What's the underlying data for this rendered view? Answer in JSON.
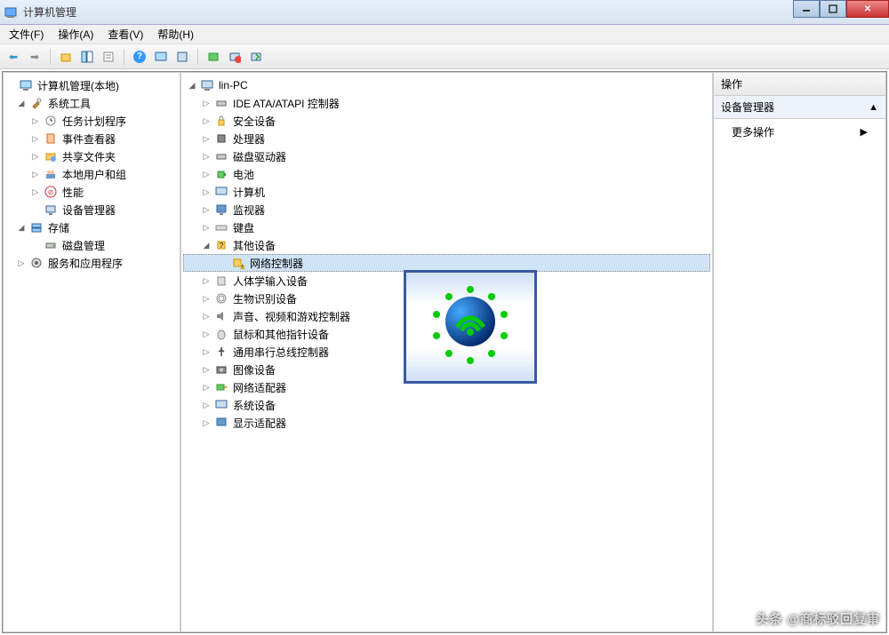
{
  "window": {
    "title": "计算机管理"
  },
  "menu": {
    "file": "文件(F)",
    "action": "操作(A)",
    "view": "查看(V)",
    "help": "帮助(H)"
  },
  "left_tree": {
    "root": "计算机管理(本地)",
    "system_tools": "系统工具",
    "task_scheduler": "任务计划程序",
    "event_viewer": "事件查看器",
    "shared_folders": "共享文件夹",
    "local_users": "本地用户和组",
    "performance": "性能",
    "device_manager": "设备管理器",
    "storage": "存储",
    "disk_management": "磁盘管理",
    "services_apps": "服务和应用程序"
  },
  "center_tree": {
    "computer": "lin-PC",
    "ide_atapi": "IDE ATA/ATAPI 控制器",
    "security_devices": "安全设备",
    "processors": "处理器",
    "disk_drives": "磁盘驱动器",
    "batteries": "电池",
    "computer_node": "计算机",
    "monitors": "监视器",
    "keyboards": "键盘",
    "other_devices": "其他设备",
    "network_controller": "网络控制器",
    "hid": "人体学输入设备",
    "biometric": "生物识别设备",
    "sound_video_game": "声音、视频和游戏控制器",
    "mice": "鼠标和其他指针设备",
    "usb_controllers": "通用串行总线控制器",
    "imaging": "图像设备",
    "network_adapters": "网络适配器",
    "system_devices": "系统设备",
    "display_adapters": "显示适配器"
  },
  "actions": {
    "header": "操作",
    "section": "设备管理器",
    "more_actions": "更多操作"
  },
  "watermark": "头条 @商标驳回复审"
}
